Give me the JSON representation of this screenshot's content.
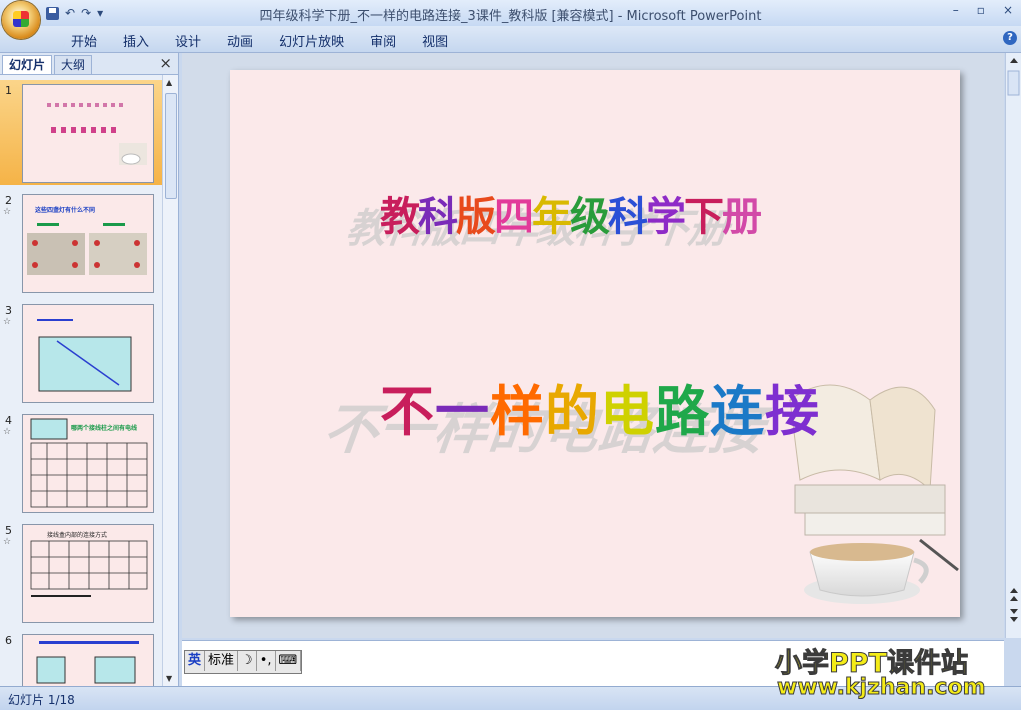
{
  "window": {
    "title": "四年级科学下册_不一样的电路连接_3课件_教科版 [兼容模式] - Microsoft PowerPoint",
    "minimize_label": "–",
    "restore_label": "▫",
    "close_label": "×"
  },
  "qat": {
    "undo": "↶",
    "redo": "↷",
    "dropdown": "▾"
  },
  "ribbon": {
    "tabs": [
      "开始",
      "插入",
      "设计",
      "动画",
      "幻灯片放映",
      "审阅",
      "视图"
    ],
    "help": "?"
  },
  "panel": {
    "tab_slides": "幻灯片",
    "tab_outline": "大纲",
    "close": "×",
    "thumbnails": [
      {
        "num": "1",
        "star": ""
      },
      {
        "num": "2",
        "star": "☆"
      },
      {
        "num": "3",
        "star": "☆"
      },
      {
        "num": "4",
        "star": "☆"
      },
      {
        "num": "5",
        "star": "☆"
      },
      {
        "num": "6",
        "star": ""
      }
    ],
    "thumb2_title": "这些四盏灯有什么不同",
    "thumb4_title": "哪两个接线柱之间有电线",
    "thumb5_title": "接线盒内部的连接方式"
  },
  "slide": {
    "title_line1": "教科版四年级科学下册",
    "title_line2": "不一样的电路连接",
    "line1_colors": [
      "#c81e5c",
      "#7a2bb8",
      "#e84a1c",
      "#e23a9a",
      "#d9b900",
      "#2a9c3b",
      "#2b4fd6",
      "#8e2bc7",
      "#c81e5c",
      "#d24aa8"
    ],
    "line2_colors": [
      "#c81e5c",
      "#7a2bb8",
      "#ff6a00",
      "#e8a800",
      "#cfd100",
      "#1fa84a",
      "#1b79c7",
      "#7e2fd0"
    ]
  },
  "ime": {
    "icon": "英",
    "mode": "标准",
    "moon": "☽",
    "punct": "•,",
    "kbd": "⌨"
  },
  "status": {
    "text": "幻灯片 1/18"
  },
  "watermark": {
    "line1": "小学PPT课件站",
    "line2": "www.kjzhan.com"
  }
}
